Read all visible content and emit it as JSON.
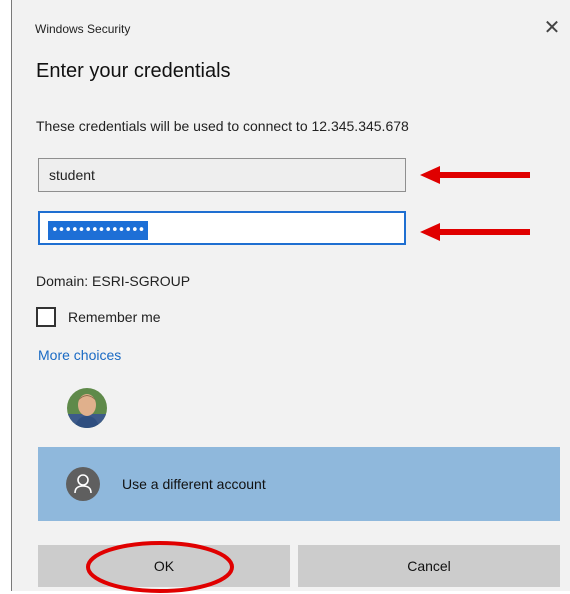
{
  "window": {
    "title": "Windows Security",
    "close_symbol": "✕"
  },
  "heading": "Enter your credentials",
  "description": "These credentials will be used to connect to 12.345.345.678",
  "username": {
    "value": "student"
  },
  "password": {
    "masked_value": "••••••••••••••",
    "selected": true
  },
  "domain_label": "Domain: ESRI-SGROUP",
  "remember_me": {
    "label": "Remember me",
    "checked": false
  },
  "more_choices": "More choices",
  "accounts": {
    "current_user_icon": "user-photo-icon",
    "different_account_label": "Use a different account",
    "different_account_icon": "person-icon"
  },
  "buttons": {
    "ok": "OK",
    "cancel": "Cancel"
  },
  "annotations": {
    "arrow_color": "#e00000",
    "highlight_circle_color": "#e00000"
  },
  "colors": {
    "dialog_bg": "#f2f2f2",
    "link": "#1a6ac4",
    "selected_account_bg": "#8fb8dc",
    "focus_border": "#1f6fd1",
    "button_bg": "#cccccc"
  }
}
